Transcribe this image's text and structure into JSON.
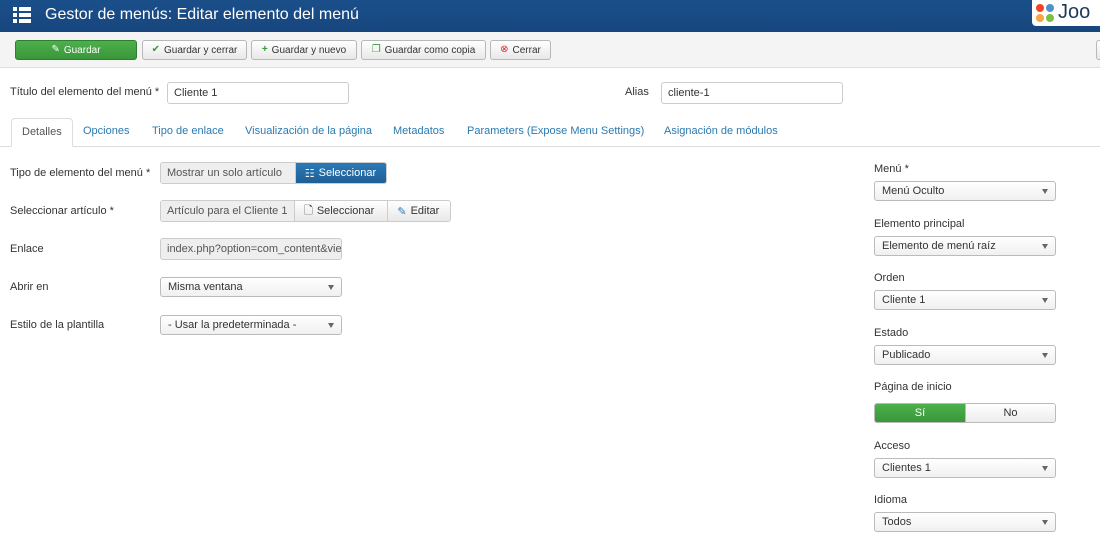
{
  "header": {
    "title": "Gestor de menús: Editar elemento del menú",
    "logo_text": "Joo"
  },
  "toolbar": {
    "save": "Guardar",
    "save_close": "Guardar y cerrar",
    "save_new": "Guardar y nuevo",
    "save_copy": "Guardar como copia",
    "close": "Cerrar"
  },
  "form": {
    "title_label": "Título del elemento del menú *",
    "title_value": "Cliente 1",
    "alias_label": "Alias",
    "alias_value": "cliente-1"
  },
  "tabs": [
    {
      "label": "Detalles"
    },
    {
      "label": "Opciones"
    },
    {
      "label": "Tipo de enlace"
    },
    {
      "label": "Visualización de la página"
    },
    {
      "label": "Metadatos"
    },
    {
      "label": "Parameters (Expose Menu Settings)"
    },
    {
      "label": "Asignación de módulos"
    }
  ],
  "details": {
    "type_label": "Tipo de elemento del menú *",
    "type_value": "Mostrar un solo artículo",
    "type_select": "Seleccionar",
    "article_label": "Seleccionar artículo *",
    "article_value": "Artículo para el Cliente 1",
    "article_select": "Seleccionar",
    "article_edit": "Editar",
    "link_label": "Enlace",
    "link_value": "index.php?option=com_content&view",
    "open_label": "Abrir en",
    "open_value": "Misma ventana",
    "style_label": "Estilo de la plantilla",
    "style_value": "- Usar la predeterminada -"
  },
  "sidebar": {
    "menu_label": "Menú *",
    "menu_value": "Menú Oculto",
    "parent_label": "Elemento principal",
    "parent_value": "Elemento de menú raíz",
    "order_label": "Orden",
    "order_value": "Cliente 1",
    "state_label": "Estado",
    "state_value": "Publicado",
    "home_label": "Página de inicio",
    "home_yes": "Sí",
    "home_no": "No",
    "access_label": "Acceso",
    "access_value": "Clientes 1",
    "lang_label": "Idioma",
    "lang_value": "Todos"
  },
  "colors": {
    "header": "#17467d",
    "success": "#46a546",
    "primary": "#2a7ab8",
    "link": "#2a7ab0"
  }
}
